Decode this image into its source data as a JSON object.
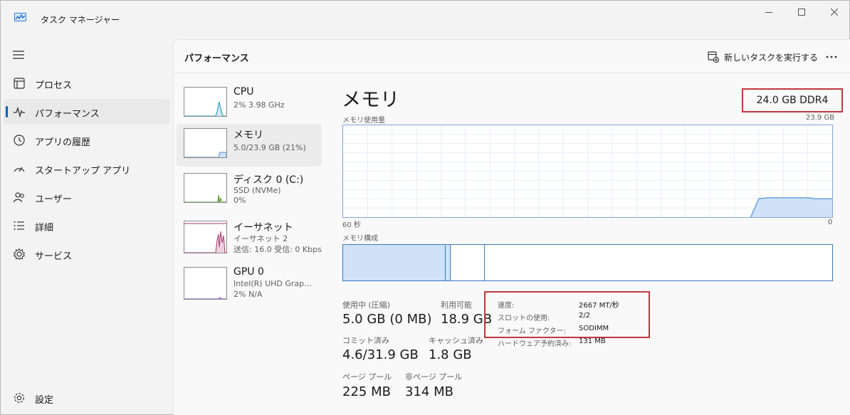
{
  "window": {
    "title": "タスク マネージャー"
  },
  "sidebar": {
    "items": [
      {
        "label": "プロセス",
        "icon": "processes-icon"
      },
      {
        "label": "パフォーマンス",
        "icon": "performance-icon",
        "active": true
      },
      {
        "label": "アプリの履歴",
        "icon": "app-history-icon"
      },
      {
        "label": "スタートアップ アプリ",
        "icon": "startup-icon"
      },
      {
        "label": "ユーザー",
        "icon": "users-icon"
      },
      {
        "label": "詳細",
        "icon": "details-icon"
      },
      {
        "label": "サービス",
        "icon": "services-icon"
      }
    ],
    "settings_label": "設定"
  },
  "header": {
    "title": "パフォーマンス",
    "run_task_label": "新しいタスクを実行する"
  },
  "perf_list": [
    {
      "name": "CPU",
      "sub1": "2%  3.98 GHz",
      "sub2": "",
      "color": "#1191c1"
    },
    {
      "name": "メモリ",
      "sub1": "5.0/23.9 GB (21%)",
      "sub2": "",
      "color": "#4a8fd6",
      "selected": true
    },
    {
      "name": "ディスク 0 (C:)",
      "sub1": "SSD (NVMe)",
      "sub2": "0%",
      "color": "#4d8a1f"
    },
    {
      "name": "イーサネット",
      "sub1": "イーサネット 2",
      "sub2": "送信: 16.0  受信: 0 Kbps",
      "color": "#a7386f"
    },
    {
      "name": "GPU 0",
      "sub1": "Intel(R) UHD Grap...",
      "sub2": "2%  N/A",
      "color": "#7a3fc4"
    }
  ],
  "detail": {
    "title": "メモリ",
    "capacity": "24.0 GB DDR4",
    "graph_label": "メモリ使用量",
    "graph_max": "23.9 GB",
    "time_left": "60 秒",
    "time_right": "0",
    "composition_label": "メモリ構成",
    "stats": {
      "in_use_label": "使用中 (圧縮)",
      "in_use_value": "5.0 GB (0 MB)",
      "available_label": "利用可能",
      "available_value": "18.9 GB",
      "committed_label": "コミット済み",
      "committed_value": "4.6/31.9 GB",
      "cached_label": "キャッシュ済み",
      "cached_value": "1.8 GB",
      "paged_label": "ページ プール",
      "paged_value": "225 MB",
      "nonpaged_label": "非ページ プール",
      "nonpaged_value": "314 MB"
    },
    "specs": [
      {
        "label": "速度:",
        "value": "2667 MT/秒"
      },
      {
        "label": "スロットの使用:",
        "value": "2/2"
      },
      {
        "label": "フォーム ファクター:",
        "value": "SODIMM"
      },
      {
        "label": "ハードウェア予約済み:",
        "value": "131 MB"
      }
    ],
    "usage_history_pct": [
      0,
      0,
      0,
      0,
      0,
      0,
      0,
      0,
      0,
      0,
      0,
      0,
      0,
      0,
      0,
      0,
      0,
      0,
      0,
      0,
      0,
      0,
      0,
      0,
      0,
      0,
      0,
      0,
      0,
      0,
      0,
      0,
      0,
      0,
      0,
      0,
      0,
      0,
      0,
      0,
      0,
      0,
      0,
      0,
      0,
      0,
      0,
      0,
      0,
      0,
      0,
      20,
      21,
      21,
      21,
      21,
      21,
      21,
      20,
      20,
      20
    ],
    "composition_fractions": {
      "in_use": 0.21,
      "modified": 0.01,
      "standby": 0.07
    }
  },
  "colors": {
    "accent": "#005fb8",
    "memory_line": "#6ba0dc",
    "memory_fill": "#cfe2f8",
    "highlight_box": "#c0393b"
  }
}
